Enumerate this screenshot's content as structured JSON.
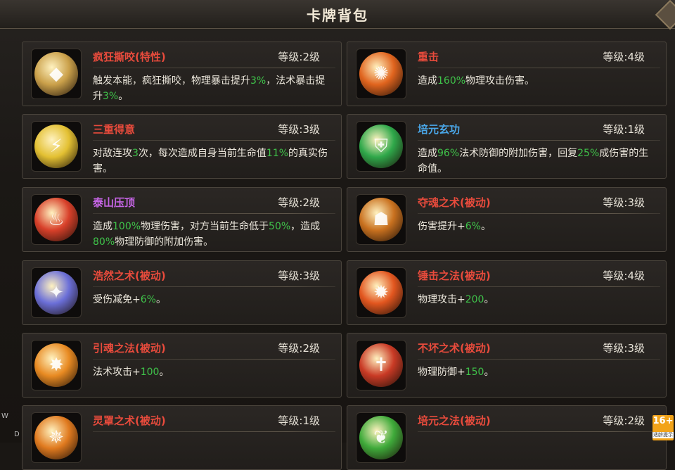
{
  "window": {
    "title": "卡牌背包"
  },
  "level_prefix": "等级:",
  "cards": [
    {
      "name": "疯狂撕咬(特性)",
      "name_color": "#e84b3c",
      "level": "2级",
      "icon": "rock-claw-icon",
      "icon_color": "#caa04a",
      "desc": [
        {
          "t": "触发本能，疯狂撕咬，物理暴击提升"
        },
        {
          "t": "3%",
          "g": true
        },
        {
          "t": "，法术暴击提升"
        },
        {
          "t": "3%",
          "g": true
        },
        {
          "t": "。"
        }
      ]
    },
    {
      "name": "重击",
      "name_color": "#e84b3c",
      "level": "4级",
      "icon": "heavy-strike-icon",
      "icon_color": "#e0641e",
      "desc": [
        {
          "t": "造成"
        },
        {
          "t": "160%",
          "g": true
        },
        {
          "t": "物理攻击伤害。"
        }
      ]
    },
    {
      "name": "三重得意",
      "name_color": "#e84b3c",
      "level": "3级",
      "icon": "triple-slash-icon",
      "icon_color": "#e3c032",
      "desc": [
        {
          "t": "对敌连攻"
        },
        {
          "t": "3",
          "g": true
        },
        {
          "t": "次，每次造成自身当前生命值"
        },
        {
          "t": "11%",
          "g": true
        },
        {
          "t": "的真实伤害。"
        }
      ]
    },
    {
      "name": "培元玄功",
      "name_color": "#4aa7e8",
      "level": "1级",
      "icon": "green-shield-icon",
      "icon_color": "#2fa84a",
      "desc": [
        {
          "t": "造成"
        },
        {
          "t": "96%",
          "g": true
        },
        {
          "t": "法术防御的附加伤害，回复"
        },
        {
          "t": "25%",
          "g": true
        },
        {
          "t": "成伤害的生命值。"
        }
      ]
    },
    {
      "name": "泰山压顶",
      "name_color": "#c765e6",
      "level": "2级",
      "icon": "boot-stomp-icon",
      "icon_color": "#d8402a",
      "desc": [
        {
          "t": "造成"
        },
        {
          "t": "100%",
          "g": true
        },
        {
          "t": "物理伤害，对方当前生命低于"
        },
        {
          "t": "50%",
          "g": true
        },
        {
          "t": "，造成"
        },
        {
          "t": "80%",
          "g": true
        },
        {
          "t": "物理防御的附加伤害。"
        }
      ]
    },
    {
      "name": "夺魂之术(被动)",
      "name_color": "#e84b3c",
      "level": "3级",
      "icon": "soul-figure-icon",
      "icon_color": "#c9711f",
      "desc": [
        {
          "t": "伤害提升+"
        },
        {
          "t": "6%",
          "g": true
        },
        {
          "t": "。"
        }
      ]
    },
    {
      "name": "浩然之术(被动)",
      "name_color": "#e84b3c",
      "level": "3级",
      "icon": "spirit-orb-icon",
      "icon_color": "#6b6fd8",
      "desc": [
        {
          "t": "受伤减免+"
        },
        {
          "t": "6%",
          "g": true
        },
        {
          "t": "。"
        }
      ]
    },
    {
      "name": "锤击之法(被动)",
      "name_color": "#e84b3c",
      "level": "4级",
      "icon": "flame-claw-icon",
      "icon_color": "#e2561f",
      "desc": [
        {
          "t": "物理攻击+"
        },
        {
          "t": "200",
          "g": true
        },
        {
          "t": "。"
        }
      ]
    },
    {
      "name": "引魂之法(被动)",
      "name_color": "#e84b3c",
      "level": "2级",
      "icon": "fire-spiral-icon",
      "icon_color": "#e88a22",
      "desc": [
        {
          "t": "法术攻击+"
        },
        {
          "t": "100",
          "g": true
        },
        {
          "t": "。"
        }
      ]
    },
    {
      "name": "不坏之术(被动)",
      "name_color": "#e84b3c",
      "level": "3级",
      "icon": "cross-shield-icon",
      "icon_color": "#c93a25",
      "desc": [
        {
          "t": "物理防御+"
        },
        {
          "t": "150",
          "g": true
        },
        {
          "t": "。"
        }
      ]
    },
    {
      "name": "灵罩之术(被动)",
      "name_color": "#e84b3c",
      "level": "1级",
      "icon": "fire-pillar-icon",
      "icon_color": "#e07a1f",
      "desc": []
    },
    {
      "name": "培元之法(被动)",
      "name_color": "#e84b3c",
      "level": "2级",
      "icon": "leaf-aura-icon",
      "icon_color": "#3faa3a",
      "desc": []
    }
  ],
  "age_badge": {
    "rating": "16+",
    "caption": "适龄提示"
  },
  "edge_marks": [
    "W",
    "D"
  ]
}
